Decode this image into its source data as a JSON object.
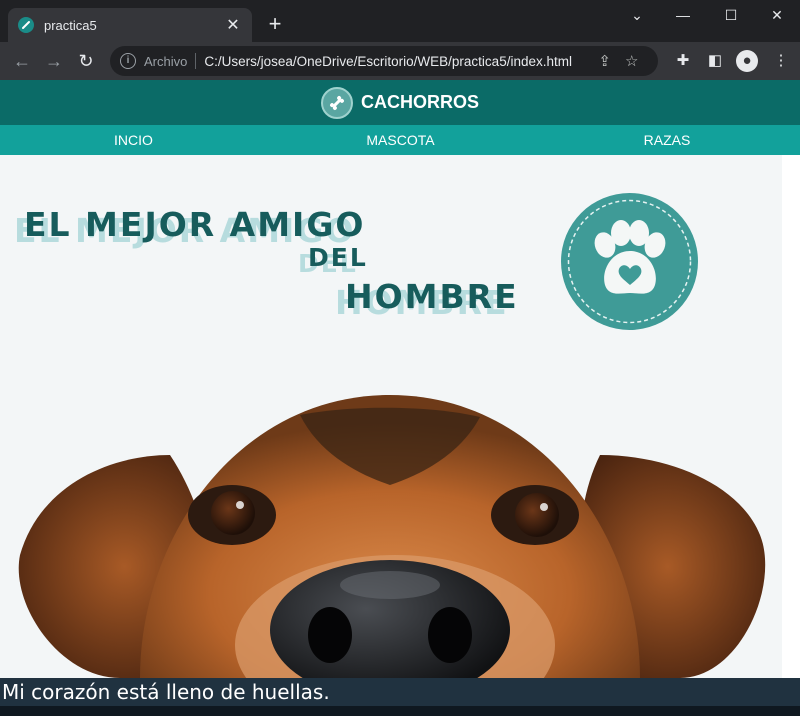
{
  "browser": {
    "tab_title": "practica5",
    "new_tab": "+",
    "omnibox_label": "Archivo",
    "url": "C:/Users/josea/OneDrive/Escritorio/WEB/practica5/index.html"
  },
  "site": {
    "brand": "CACHORROS",
    "nav": [
      "INCIO",
      "MASCOTA",
      "RAZAS"
    ]
  },
  "hero": {
    "line1": "EL MEJOR AMIGO",
    "line2": "DEL",
    "line3": "HOMBRE"
  },
  "caption": "Mi corazón está lleno de huellas.",
  "colors": {
    "header": "#0b6b67",
    "nav": "#12a19b",
    "headline": "#175c5c",
    "badge": "#3f9b97",
    "caption_bg": "#203240"
  },
  "icons": [
    "bone-icon",
    "paw-icon",
    "heart-icon",
    "back-icon",
    "forward-icon",
    "reload-icon",
    "info-icon",
    "share-icon",
    "star-icon",
    "extensions-icon",
    "sidebar-icon",
    "profile-icon",
    "menu-icon"
  ]
}
